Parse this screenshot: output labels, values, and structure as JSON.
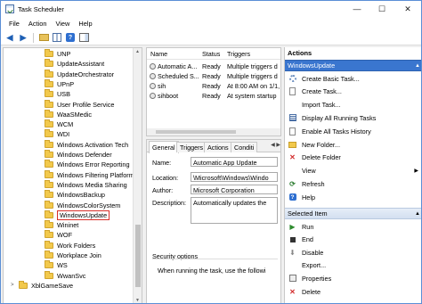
{
  "window": {
    "title": "Task Scheduler",
    "controls": [
      "—",
      "☐",
      "✕"
    ]
  },
  "menu": [
    "File",
    "Action",
    "View",
    "Help"
  ],
  "tree": {
    "items": [
      {
        "label": "UNP"
      },
      {
        "label": "UpdateAssistant"
      },
      {
        "label": "UpdateOrchestrator"
      },
      {
        "label": "UPnP"
      },
      {
        "label": "USB"
      },
      {
        "label": "User Profile Service"
      },
      {
        "label": "WaaSMedic"
      },
      {
        "label": "WCM"
      },
      {
        "label": "WDI"
      },
      {
        "label": "Windows Activation Tech"
      },
      {
        "label": "Windows Defender"
      },
      {
        "label": "Windows Error Reporting"
      },
      {
        "label": "Windows Filtering Platform"
      },
      {
        "label": "Windows Media Sharing"
      },
      {
        "label": "WindowsBackup"
      },
      {
        "label": "WindowsColorSystem"
      },
      {
        "label": "WindowsUpdate",
        "selected": true
      },
      {
        "label": "Wininet"
      },
      {
        "label": "WOF"
      },
      {
        "label": "Work Folders"
      },
      {
        "label": "Workplace Join"
      },
      {
        "label": "WS"
      },
      {
        "label": "WwanSvc"
      },
      {
        "label": "XblGameSave"
      }
    ]
  },
  "task_list": {
    "columns": [
      "Name",
      "Status",
      "Triggers"
    ],
    "rows": [
      {
        "name": "Automatic A...",
        "status": "Ready",
        "triggers": "Multiple triggers d"
      },
      {
        "name": "Scheduled S...",
        "status": "Ready",
        "triggers": "Multiple triggers d"
      },
      {
        "name": "sih",
        "status": "Ready",
        "triggers": "At 8:00 AM on 1/1,"
      },
      {
        "name": "sihboot",
        "status": "Ready",
        "triggers": "At system startup"
      }
    ]
  },
  "details": {
    "tabs": [
      "General",
      "Triggers",
      "Actions",
      "Conditi"
    ],
    "name_label": "Name:",
    "name_value": "Automatic App Update",
    "location_label": "Location:",
    "location_value": "\\Microsoft\\Windows\\Windo",
    "author_label": "Author:",
    "author_value": "Microsoft Corporation",
    "description_label": "Description:",
    "description_value": "Automatically updates the",
    "security_title": "Security options",
    "security_text": "When running the task, use the followi"
  },
  "actions": {
    "header": "Actions",
    "section1": "WindowsUpdate",
    "section1_items": [
      {
        "label": "Create Basic Task...",
        "icon": "gear"
      },
      {
        "label": "Create Task...",
        "icon": "page"
      },
      {
        "label": "Import Task...",
        "icon": "none"
      },
      {
        "label": "Display All Running Tasks",
        "icon": "list"
      },
      {
        "label": "Enable All Tasks History",
        "icon": "page"
      },
      {
        "label": "New Folder...",
        "icon": "folder"
      },
      {
        "label": "Delete Folder",
        "icon": "x"
      },
      {
        "label": "View",
        "icon": "none"
      },
      {
        "label": "Refresh",
        "icon": "refresh"
      },
      {
        "label": "Help",
        "icon": "help"
      }
    ],
    "section2": "Selected Item",
    "section2_items": [
      {
        "label": "Run",
        "icon": "run"
      },
      {
        "label": "End",
        "icon": "end"
      },
      {
        "label": "Disable",
        "icon": "disable"
      },
      {
        "label": "Export...",
        "icon": "none"
      },
      {
        "label": "Properties",
        "icon": "prop"
      },
      {
        "label": "Delete",
        "icon": "x"
      }
    ]
  }
}
